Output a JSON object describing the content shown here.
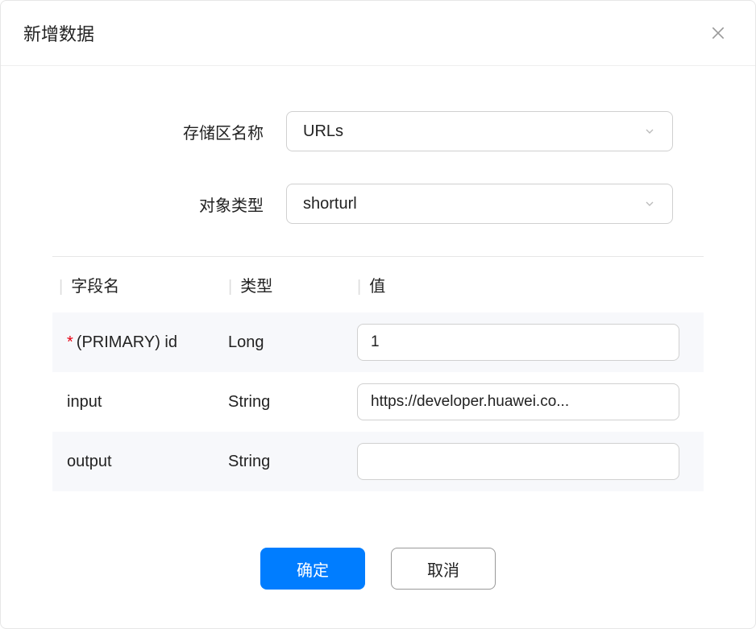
{
  "modal": {
    "title": "新增数据",
    "close_icon": "close"
  },
  "form": {
    "storage": {
      "label": "存储区名称",
      "value": "URLs"
    },
    "objectType": {
      "label": "对象类型",
      "value": "shorturl"
    }
  },
  "table": {
    "headers": {
      "field": "字段名",
      "type": "类型",
      "value": "值"
    },
    "rows": [
      {
        "required": true,
        "field": "(PRIMARY) id",
        "type": "Long",
        "value": "1"
      },
      {
        "required": false,
        "field": "input",
        "type": "String",
        "value": "https://developer.huawei.co..."
      },
      {
        "required": false,
        "field": "output",
        "type": "String",
        "value": ""
      }
    ]
  },
  "footer": {
    "ok": "确定",
    "cancel": "取消"
  }
}
